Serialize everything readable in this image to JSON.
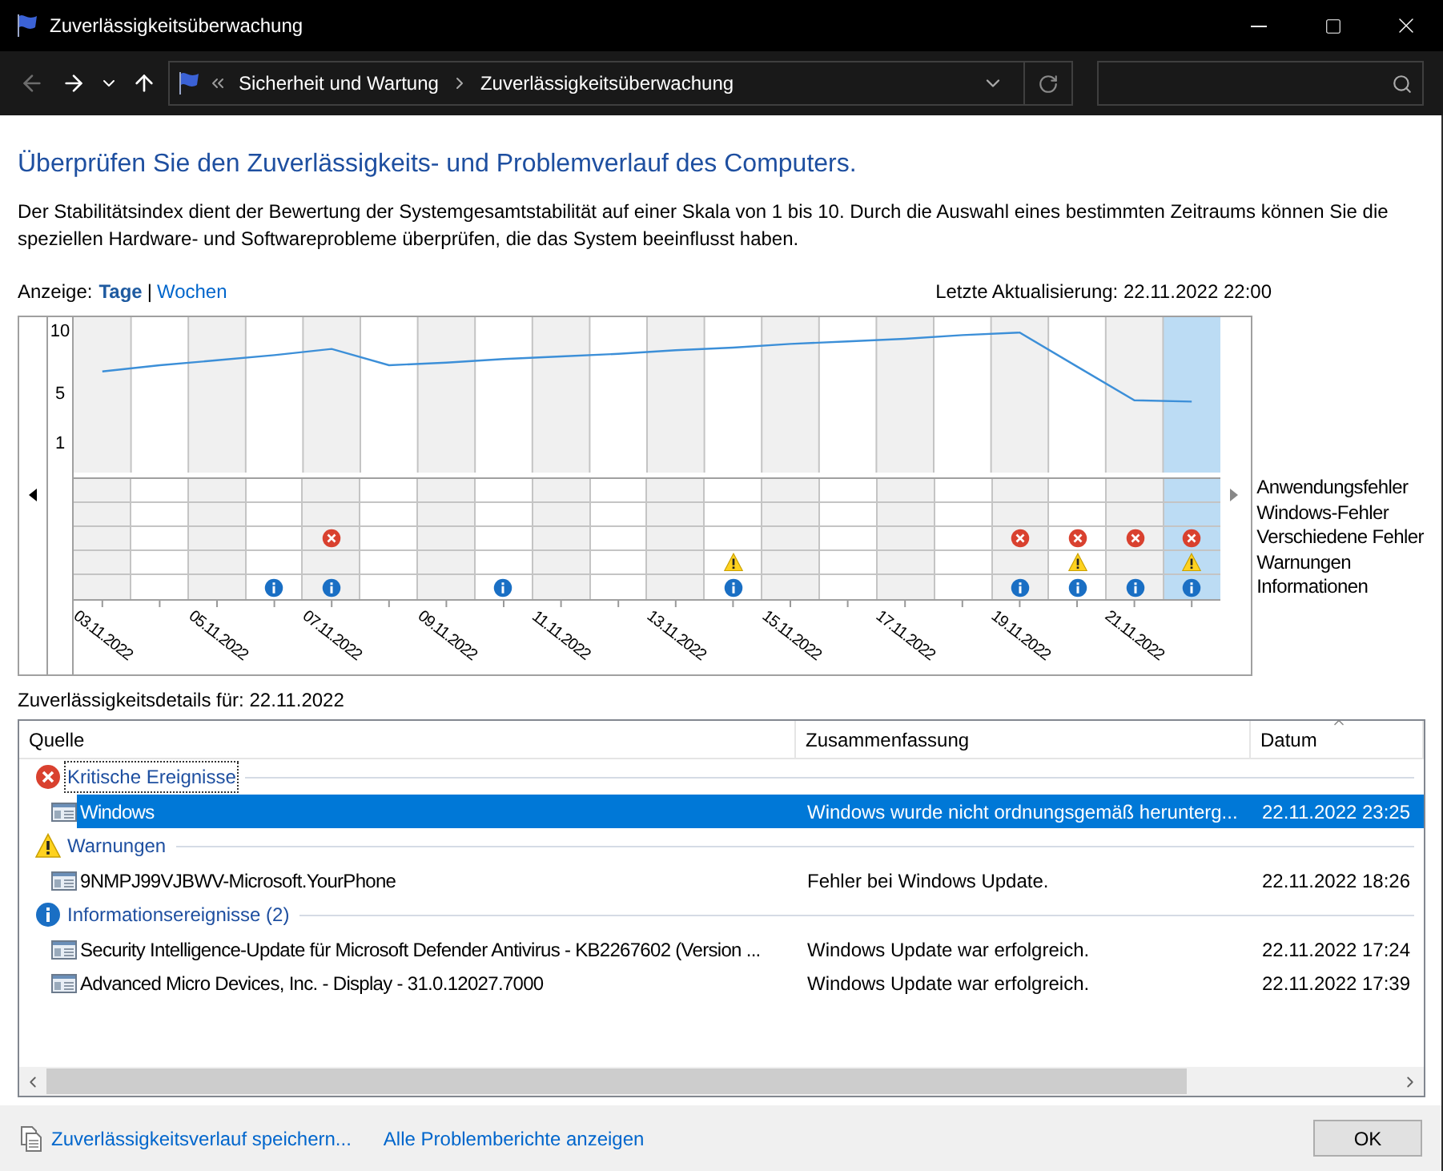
{
  "window": {
    "title": "Zuverlässigkeitsüberwachung"
  },
  "navigation": {
    "back": {
      "disabled": true
    },
    "forward": {
      "disabled": false
    }
  },
  "address_bar": {
    "path": [
      "Sicherheit und Wartung",
      "Zuverlässigkeitsüberwachung"
    ]
  },
  "heading": "Überprüfen Sie den Zuverlässigkeits- und Problemverlauf des Computers.",
  "description": "Der Stabilitätsindex dient der Bewertung der Systemgesamtstabilität auf einer Skala von 1 bis 10. Durch die Auswahl eines bestimmten Zeitraums können Sie die speziellen Hardware- und Softwareprobleme überprüfen, die das System beeinflusst haben.",
  "view": {
    "label": "Anzeige:",
    "separator": "|",
    "options": [
      {
        "label": "Tage",
        "selected": true
      },
      {
        "label": "Wochen",
        "selected": false
      }
    ]
  },
  "last_update": "Letzte Aktualisierung: 22.11.2022 22:00",
  "stability_chart": {
    "chart_data": {
      "type": "line",
      "ylim": [
        -17.32,
        11.125
      ],
      "yticks": [
        1,
        5,
        10
      ],
      "categories": [
        "03.11.2022",
        null,
        "05.11.2022",
        null,
        "07.11.2022",
        null,
        "09.11.2022",
        null,
        "11.11.2022",
        null,
        "13.11.2022",
        null,
        "15.11.2022",
        null,
        "17.11.2022",
        null,
        "19.11.2022",
        null,
        "21.11.2022",
        null
      ],
      "series": [
        {
          "color": "#3c8fd8",
          "values": [
            6.8,
            7.3,
            7.7,
            8.1,
            8.6,
            7.3,
            7.5,
            7.8,
            8.0,
            8.2,
            8.5,
            8.7,
            9.0,
            9.2,
            9.4,
            9.7,
            9.9,
            7.2,
            4.5,
            4.4
          ]
        }
      ]
    }
  },
  "event_rows": [
    {
      "label": "Anwendungsfehler",
      "kind": "app_error"
    },
    {
      "label": "Windows-Fehler",
      "kind": "windows_error"
    },
    {
      "label": "Verschiedene Fehler",
      "kind": "misc_error"
    },
    {
      "label": "Warnungen",
      "kind": "warning"
    },
    {
      "label": "Informationen",
      "kind": "info"
    }
  ],
  "columns": [
    {
      "selected": false,
      "app_error": false,
      "windows_error": false,
      "misc_error": false,
      "warning": false,
      "info": false
    },
    {
      "selected": false,
      "app_error": false,
      "windows_error": false,
      "misc_error": false,
      "warning": false,
      "info": false
    },
    {
      "selected": false,
      "app_error": false,
      "windows_error": false,
      "misc_error": false,
      "warning": false,
      "info": false
    },
    {
      "selected": false,
      "app_error": false,
      "windows_error": false,
      "misc_error": false,
      "warning": false,
      "info": true
    },
    {
      "selected": false,
      "app_error": false,
      "windows_error": false,
      "misc_error": true,
      "warning": false,
      "info": true
    },
    {
      "selected": false,
      "app_error": false,
      "windows_error": false,
      "misc_error": false,
      "warning": false,
      "info": false
    },
    {
      "selected": false,
      "app_error": false,
      "windows_error": false,
      "misc_error": false,
      "warning": false,
      "info": false
    },
    {
      "selected": false,
      "app_error": false,
      "windows_error": false,
      "misc_error": false,
      "warning": false,
      "info": true
    },
    {
      "selected": false,
      "app_error": false,
      "windows_error": false,
      "misc_error": false,
      "warning": false,
      "info": false
    },
    {
      "selected": false,
      "app_error": false,
      "windows_error": false,
      "misc_error": false,
      "warning": false,
      "info": false
    },
    {
      "selected": false,
      "app_error": false,
      "windows_error": false,
      "misc_error": false,
      "warning": false,
      "info": false
    },
    {
      "selected": false,
      "app_error": false,
      "windows_error": false,
      "misc_error": false,
      "warning": true,
      "info": true
    },
    {
      "selected": false,
      "app_error": false,
      "windows_error": false,
      "misc_error": false,
      "warning": false,
      "info": false
    },
    {
      "selected": false,
      "app_error": false,
      "windows_error": false,
      "misc_error": false,
      "warning": false,
      "info": false
    },
    {
      "selected": false,
      "app_error": false,
      "windows_error": false,
      "misc_error": false,
      "warning": false,
      "info": false
    },
    {
      "selected": false,
      "app_error": false,
      "windows_error": false,
      "misc_error": false,
      "warning": false,
      "info": false
    },
    {
      "selected": false,
      "app_error": false,
      "windows_error": false,
      "misc_error": true,
      "warning": false,
      "info": true
    },
    {
      "selected": false,
      "app_error": false,
      "windows_error": false,
      "misc_error": true,
      "warning": true,
      "info": true
    },
    {
      "selected": false,
      "app_error": false,
      "windows_error": false,
      "misc_error": true,
      "warning": false,
      "info": true
    },
    {
      "selected": true,
      "app_error": false,
      "windows_error": false,
      "misc_error": true,
      "warning": true,
      "info": true
    }
  ],
  "details": {
    "title": "Zuverlässigkeitsdetails für: 22.11.2022",
    "columns": [
      "Quelle",
      "Zusammenfassung",
      "Datum"
    ],
    "groups": [
      {
        "kind": "critical",
        "label": "Kritische Ereignisse",
        "focused": true,
        "rows": [
          {
            "source": "Windows",
            "summary": "Windows wurde nicht ordnungsgemäß herunterg...",
            "date": "22.11.2022 23:25",
            "selected": true
          }
        ]
      },
      {
        "kind": "warning",
        "label": "Warnungen",
        "focused": false,
        "rows": [
          {
            "source": "9NMPJ99VJBWV-Microsoft.YourPhone",
            "summary": "Fehler bei Windows Update.",
            "date": "22.11.2022 18:26",
            "selected": false
          }
        ]
      },
      {
        "kind": "info",
        "label": "Informationsereignisse (2)",
        "focused": false,
        "rows": [
          {
            "source": "Security Intelligence-Update für Microsoft Defender Antivirus - KB2267602 (Version ...",
            "summary": "Windows Update war erfolgreich.",
            "date": "22.11.2022 17:24",
            "selected": false
          },
          {
            "source": "Advanced Micro Devices, Inc. - Display - 31.0.12027.7000",
            "summary": "Windows Update war erfolgreich.",
            "date": "22.11.2022 17:39",
            "selected": false
          }
        ]
      }
    ]
  },
  "footer": {
    "links": [
      "Zuverlässigkeitsverlauf speichern...",
      "Alle Problemberichte anzeigen"
    ],
    "ok": "OK"
  }
}
